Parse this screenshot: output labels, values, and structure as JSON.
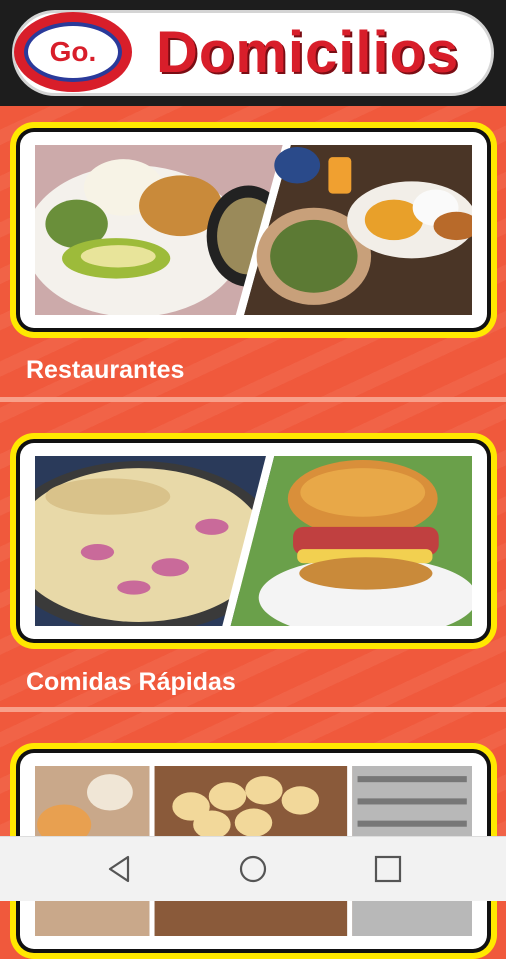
{
  "header": {
    "logo_text": "Go.",
    "brand_title": "Domicilios"
  },
  "categories": [
    {
      "label": "Restaurantes",
      "image": "food-plates-photo"
    },
    {
      "label": "Comidas Rápidas",
      "image": "pizza-burger-photo"
    },
    {
      "label": "",
      "image": "bakery-photo"
    }
  ],
  "navbar": {
    "back_icon": "back-triangle-icon",
    "home_icon": "home-circle-icon",
    "recents_icon": "recents-square-icon"
  },
  "colors": {
    "background": "#f0593c",
    "card_border": "#ffe800",
    "brand_red": "#d81e2a",
    "brand_blue": "#2a3a9a"
  }
}
